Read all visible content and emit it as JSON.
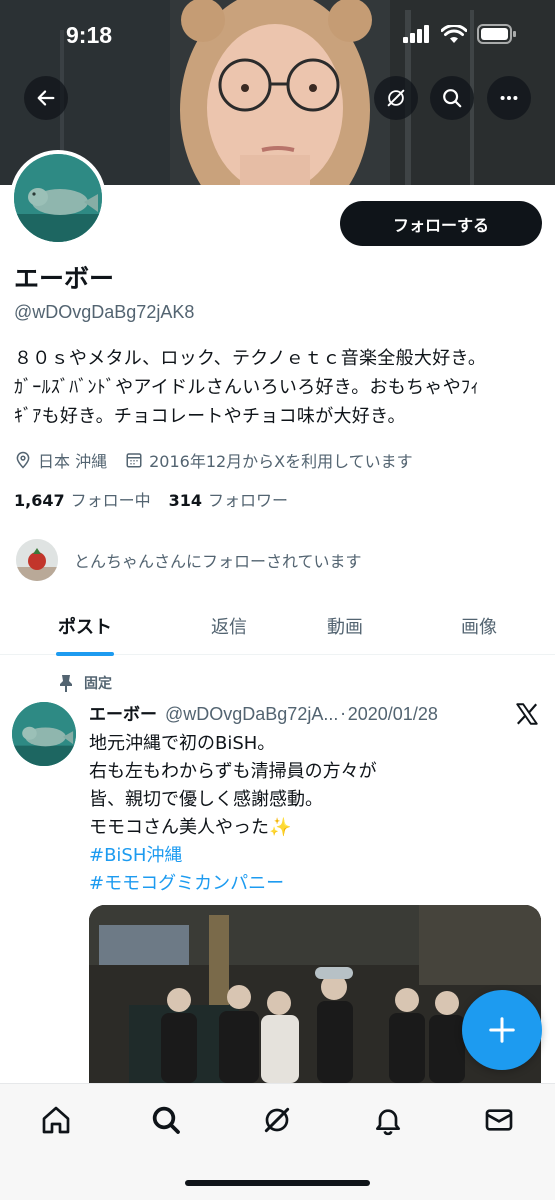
{
  "status_bar": {
    "time": "9:18",
    "icons": [
      "signal-icon",
      "wifi-icon",
      "battery-icon"
    ]
  },
  "banner": {
    "back_button": "back-arrow-icon",
    "actions": [
      "grok-icon",
      "search-icon",
      "more-icon"
    ]
  },
  "profile": {
    "display_name": "エーボー",
    "handle": "@wDOvgDaBg72jAK8",
    "follow_label": "フォローする",
    "bio_lines": [
      "８０ｓやメタル、ロック、テクノｅｔｃ音楽全般大好き。",
      "ｶﾞｰﾙｽﾞﾊﾞﾝﾄﾞやアイドルさんいろいろ好き。おもちゃやﾌｨ",
      "ｷﾞｱも好き。チョコレートやチョコ味が大好き。"
    ],
    "location": "日本 沖縄",
    "joined": "2016年12月からXを利用しています",
    "following_count": "1,647",
    "following_label": "フォロー中",
    "followers_count": "314",
    "followers_label": "フォロワー",
    "followed_by_text": "とんちゃんさんにフォローされています"
  },
  "tabs": [
    {
      "label": "ポスト",
      "active": true
    },
    {
      "label": "返信",
      "active": false
    },
    {
      "label": "動画",
      "active": false
    },
    {
      "label": "画像",
      "active": false
    }
  ],
  "pinned_tweet": {
    "pinned_label": "固定",
    "name": "エーボー",
    "handle": "@wDOvgDaBg72jA...",
    "separator": "·",
    "date": "2020/01/28",
    "lines": [
      "地元沖縄で初のBiSH。",
      "右も左もわからずも清掃員の方々が",
      "皆、親切で優しく感謝感動。",
      "モモコさん美人やった✨"
    ],
    "hashtags": [
      "#BiSH沖縄",
      "#モモコグミカンパニー"
    ]
  },
  "fab": {
    "icon": "plus-icon"
  },
  "bottom_nav": [
    "home-icon",
    "search-icon",
    "grok-icon",
    "notifications-icon",
    "messages-icon"
  ],
  "colors": {
    "accent": "#1d9bf0",
    "text": "#0f1419",
    "secondary": "#536471",
    "button_dark": "#0f1419"
  }
}
